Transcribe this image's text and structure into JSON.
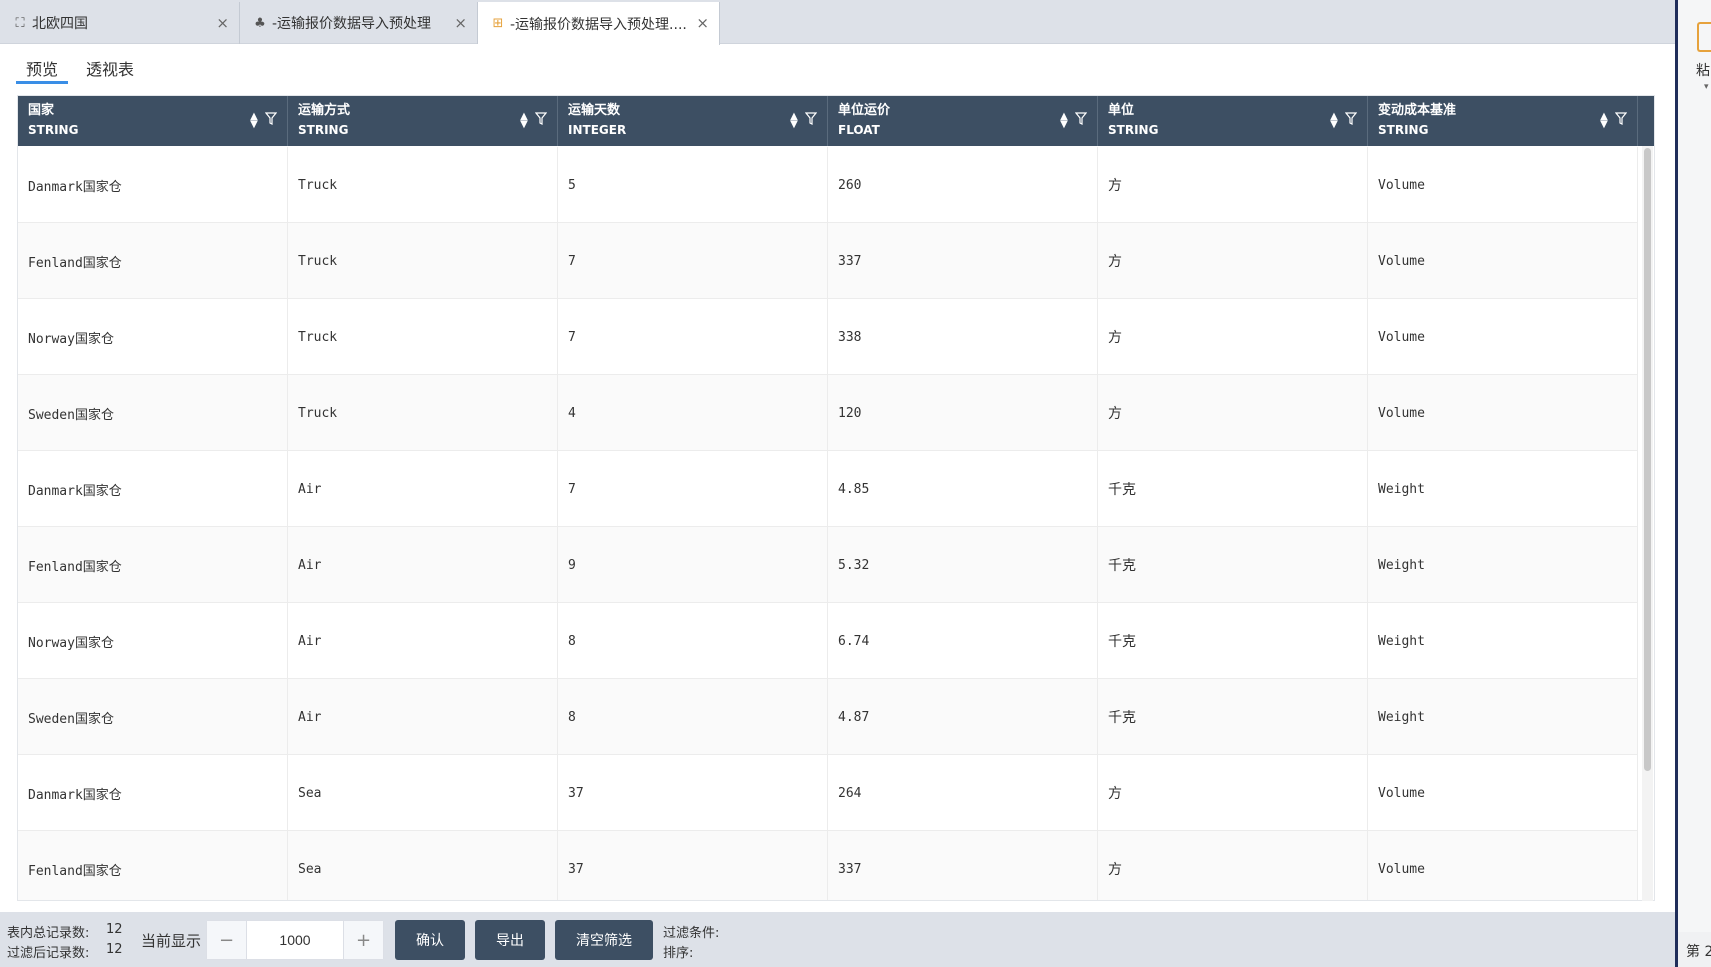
{
  "tabs": [
    {
      "icon": "sitemap-icon",
      "icon_glyph": "⛶",
      "label": "北欧四国",
      "close": "×"
    },
    {
      "icon": "cubes-icon",
      "icon_glyph": "♣",
      "label": "-运输报价数据导入预处理",
      "close": "×"
    },
    {
      "icon": "table-icon",
      "icon_glyph": "⊞",
      "label": "-运输报价数据导入预处理....",
      "close": "×",
      "active": true
    }
  ],
  "subtabs": [
    {
      "label": "预览",
      "active": true
    },
    {
      "label": "透视表",
      "active": false
    }
  ],
  "columns": [
    {
      "name": "国家",
      "type": "STRING"
    },
    {
      "name": "运输方式",
      "type": "STRING"
    },
    {
      "name": "运输天数",
      "type": "INTEGER"
    },
    {
      "name": "单位运价",
      "type": "FLOAT"
    },
    {
      "name": "单位",
      "type": "STRING"
    },
    {
      "name": "变动成本基准",
      "type": "STRING"
    }
  ],
  "sort_glyph": "▲▼",
  "rows": [
    [
      "Danmark国家仓",
      "Truck",
      "5",
      "260",
      "方",
      "Volume"
    ],
    [
      "Fenland国家仓",
      "Truck",
      "7",
      "337",
      "方",
      "Volume"
    ],
    [
      "Norway国家仓",
      "Truck",
      "7",
      "338",
      "方",
      "Volume"
    ],
    [
      "Sweden国家仓",
      "Truck",
      "4",
      "120",
      "方",
      "Volume"
    ],
    [
      "Danmark国家仓",
      "Air",
      "7",
      "4.85",
      "千克",
      "Weight"
    ],
    [
      "Fenland国家仓",
      "Air",
      "9",
      "5.32",
      "千克",
      "Weight"
    ],
    [
      "Norway国家仓",
      "Air",
      "8",
      "6.74",
      "千克",
      "Weight"
    ],
    [
      "Sweden国家仓",
      "Air",
      "8",
      "4.87",
      "千克",
      "Weight"
    ],
    [
      "Danmark国家仓",
      "Sea",
      "37",
      "264",
      "方",
      "Volume"
    ],
    [
      "Fenland国家仓",
      "Sea",
      "37",
      "337",
      "方",
      "Volume"
    ]
  ],
  "footer": {
    "total_label": "表内总记录数:",
    "total_value": "12",
    "filtered_label": "过滤后记录数:",
    "filtered_value": "12",
    "current_display_label": "当前显示",
    "stepper_minus": "−",
    "stepper_plus": "+",
    "display_count": "1000",
    "confirm_label": "确认",
    "export_label": "导出",
    "clear_filter_label": "清空筛选",
    "filter_condition_label": "过滤条件:",
    "sort_label": "排序:"
  },
  "right_pane": {
    "icon": "paste-icon",
    "label": "粘",
    "arrow": "▾",
    "footer_label": "第 2"
  },
  "colors": {
    "header_bg": "#3d4f63",
    "accent": "#3a8ee6",
    "tabbar_bg": "#dde1e8",
    "active_tab_icon": "#e6a23c"
  }
}
